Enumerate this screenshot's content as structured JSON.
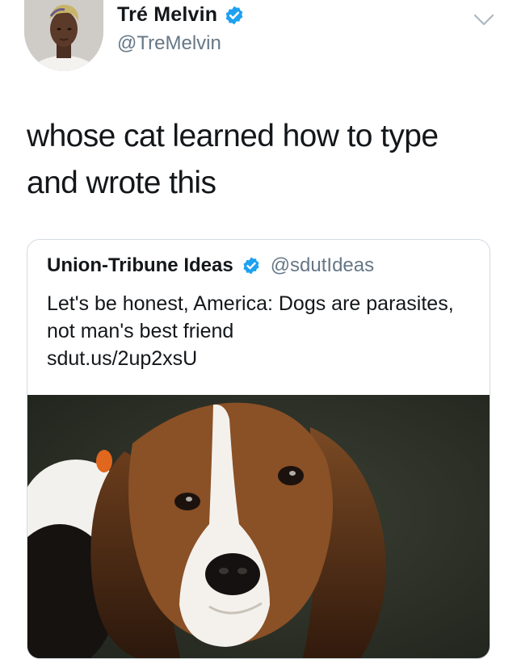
{
  "tweet": {
    "author": {
      "display_name": "Tré Melvin",
      "handle": "@TreMelvin",
      "verified": true
    },
    "text": "whose cat learned how to type and wrote this",
    "quoted_tweet": {
      "author": {
        "display_name": "Union-Tribune Ideas",
        "handle": "@sdutIdeas",
        "verified": true
      },
      "text": "Let's be honest, America: Dogs are parasites, not man's best friend\nsdut.us/2up2xsU",
      "image_subject": "beagle-puppy-photo"
    }
  },
  "icons": {
    "verified": "verified-badge-icon",
    "menu": "chevron-down-icon"
  },
  "colors": {
    "verified_blue": "#1da1f2",
    "secondary_text": "#657786",
    "primary_text": "#14171a",
    "card_border": "#d3dbe2"
  }
}
